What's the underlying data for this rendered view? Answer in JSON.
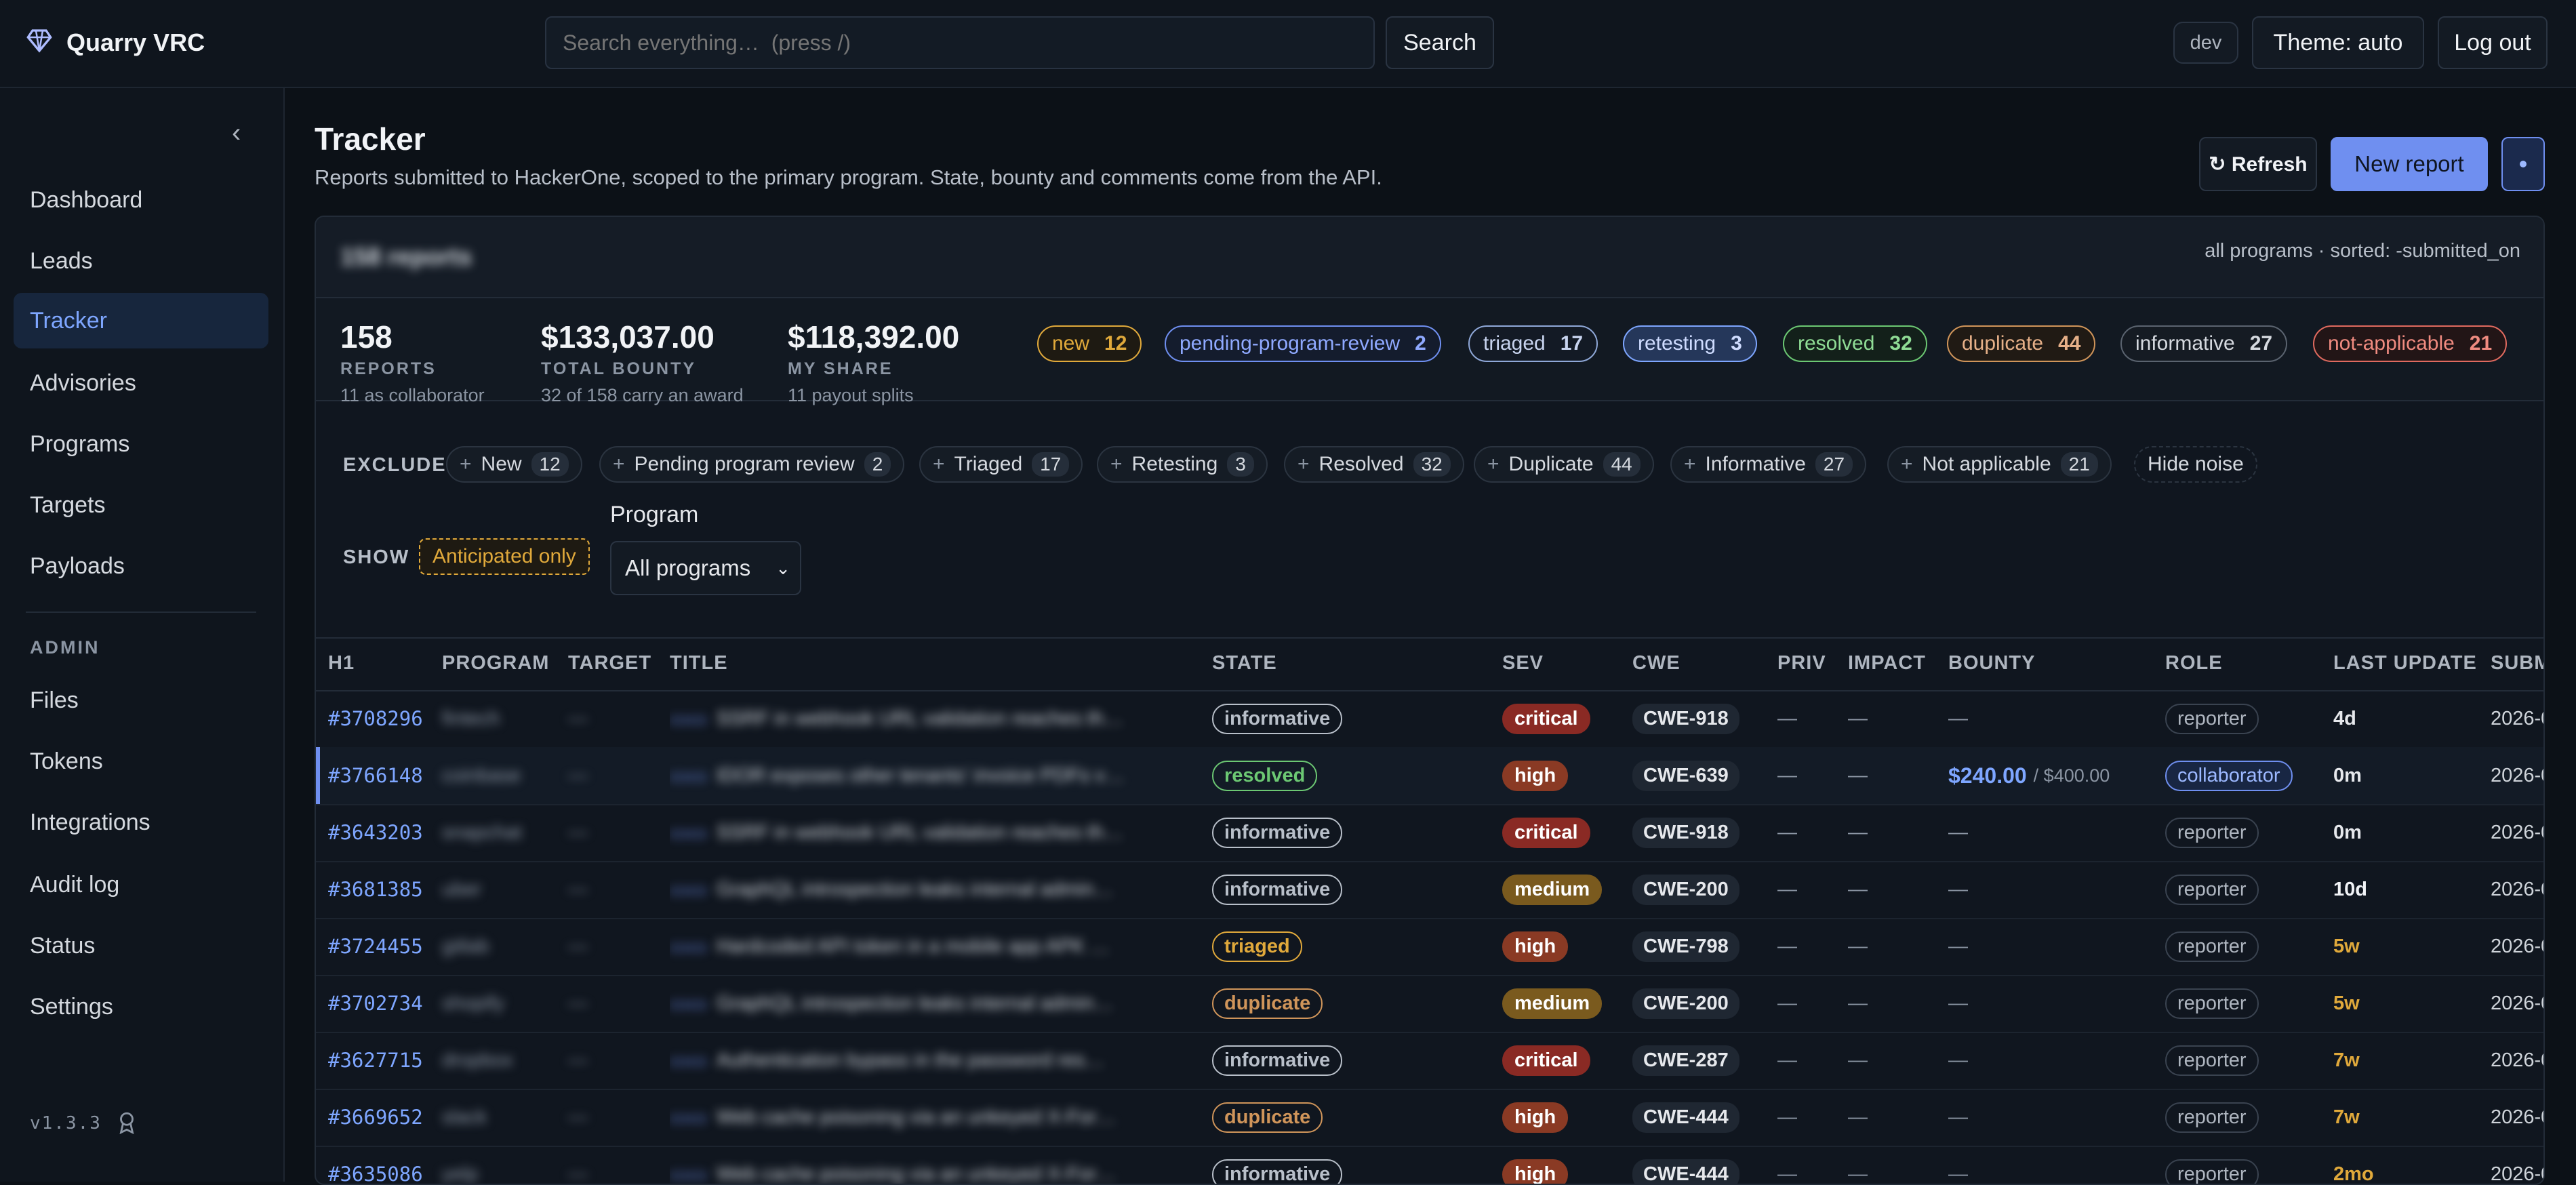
{
  "app": {
    "name": "Quarry VRC"
  },
  "search": {
    "placeholder": "Search everything…  (press /)",
    "button": "Search"
  },
  "top_actions": {
    "env_badge": "dev",
    "theme": "Theme: auto",
    "logout": "Log out"
  },
  "sidebar": {
    "items": [
      "Dashboard",
      "Leads",
      "Tracker",
      "Advisories",
      "Programs",
      "Targets",
      "Payloads"
    ],
    "admin_label": "ADMIN",
    "admin_items": [
      "Files",
      "Tokens",
      "Integrations",
      "Audit log",
      "Status",
      "Settings"
    ],
    "version": "v1.3.3",
    "active": "Tracker"
  },
  "page": {
    "title": "Tracker",
    "subtitle": "Reports submitted to HackerOne, scoped to the primary program. State, bounty and comments come from the API.",
    "refresh": "↻ Refresh",
    "new_report": "New report"
  },
  "panel": {
    "heading": "158 reports",
    "sort_info": "all programs · sorted: -submitted_on"
  },
  "stats": [
    {
      "value": "158",
      "label": "REPORTS",
      "sub": "11 as collaborator"
    },
    {
      "value": "$133,037.00",
      "label": "TOTAL BOUNTY",
      "sub": "32 of 158 carry an award"
    },
    {
      "value": "$118,392.00",
      "label": "MY SHARE",
      "sub": "11 payout splits"
    }
  ],
  "state_pills": [
    {
      "label": "new",
      "count": "12",
      "color": "#e0a93b"
    },
    {
      "label": "pending-program-review",
      "count": "2",
      "color": "#6f8ff0"
    },
    {
      "label": "triaged",
      "count": "17",
      "color": "#8fa8d8"
    },
    {
      "label": "retesting",
      "count": "3",
      "color": "#7ea6ff"
    },
    {
      "label": "resolved",
      "count": "32",
      "color": "#6cc873"
    },
    {
      "label": "duplicate",
      "count": "44",
      "color": "#d0955a"
    },
    {
      "label": "informative",
      "count": "27",
      "color": "#b8bfc9"
    },
    {
      "label": "not-applicable",
      "count": "21",
      "color": "#e06a5f"
    }
  ],
  "exclude": {
    "label": "EXCLUDE",
    "chips": [
      {
        "label": "New",
        "count": "12"
      },
      {
        "label": "Pending program review",
        "count": "2"
      },
      {
        "label": "Triaged",
        "count": "17"
      },
      {
        "label": "Retesting",
        "count": "3"
      },
      {
        "label": "Resolved",
        "count": "32"
      },
      {
        "label": "Duplicate",
        "count": "44"
      },
      {
        "label": "Informative",
        "count": "27"
      },
      {
        "label": "Not applicable",
        "count": "21"
      }
    ],
    "hide_noise": "Hide noise"
  },
  "show": {
    "label": "SHOW",
    "anticipated": "Anticipated only",
    "program_label": "Program",
    "program_value": "All programs"
  },
  "table": {
    "columns": [
      "H1",
      "PROGRAM",
      "TARGET",
      "TITLE",
      "STATE",
      "SEV",
      "CWE",
      "PRIV",
      "IMPACT",
      "BOUNTY",
      "ROLE",
      "LAST UPDATE",
      "SUBMITTED"
    ],
    "rows": [
      {
        "id": "#3708296",
        "program": "fintech",
        "target": "—",
        "title": "SSRF in webhook URL validation reaches th…",
        "state": "informative",
        "sev": "critical",
        "cwe": "CWE-918",
        "priv": "—",
        "impact": "—",
        "bounty": "—",
        "bounty_total": "",
        "role": "reporter",
        "updated": "4d",
        "updated_color": "#e6e8ec",
        "submitted": "2026-0"
      },
      {
        "id": "#3766148",
        "program": "coinbase",
        "target": "—",
        "title": "IDOR exposes other tenants' invoice PDFs v…",
        "state": "resolved",
        "sev": "high",
        "cwe": "CWE-639",
        "priv": "—",
        "impact": "—",
        "bounty": "$240.00",
        "bounty_total": "/ $400.00",
        "role": "collaborator",
        "updated": "0m",
        "updated_color": "#e6e8ec",
        "submitted": "2026-0"
      },
      {
        "id": "#3643203",
        "program": "snapchat",
        "target": "—",
        "title": "SSRF in webhook URL validation reaches th…",
        "state": "informative",
        "sev": "critical",
        "cwe": "CWE-918",
        "priv": "—",
        "impact": "—",
        "bounty": "—",
        "bounty_total": "",
        "role": "reporter",
        "updated": "0m",
        "updated_color": "#e6e8ec",
        "submitted": "2026-0"
      },
      {
        "id": "#3681385",
        "program": "uber",
        "target": "—",
        "title": "GraphQL introspection leaks internal admin…",
        "state": "informative",
        "sev": "medium",
        "cwe": "CWE-200",
        "priv": "—",
        "impact": "—",
        "bounty": "—",
        "bounty_total": "",
        "role": "reporter",
        "updated": "10d",
        "updated_color": "#f1f3f6",
        "submitted": "2026-0"
      },
      {
        "id": "#3724455",
        "program": "gitlab",
        "target": "—",
        "title": "Hardcoded API token in a mobile app APK …",
        "state": "triaged",
        "sev": "high",
        "cwe": "CWE-798",
        "priv": "—",
        "impact": "—",
        "bounty": "—",
        "bounty_total": "",
        "role": "reporter",
        "updated": "5w",
        "updated_color": "#e0a93b",
        "submitted": "2026-0"
      },
      {
        "id": "#3702734",
        "program": "shopify",
        "target": "—",
        "title": "GraphQL introspection leaks internal admin…",
        "state": "duplicate",
        "sev": "medium",
        "cwe": "CWE-200",
        "priv": "—",
        "impact": "—",
        "bounty": "—",
        "bounty_total": "",
        "role": "reporter",
        "updated": "5w",
        "updated_color": "#e0a93b",
        "submitted": "2026-0"
      },
      {
        "id": "#3627715",
        "program": "dropbox",
        "target": "—",
        "title": "Authentication bypass in the password res…",
        "state": "informative",
        "sev": "critical",
        "cwe": "CWE-287",
        "priv": "—",
        "impact": "—",
        "bounty": "—",
        "bounty_total": "",
        "role": "reporter",
        "updated": "7w",
        "updated_color": "#e0a93b",
        "submitted": "2026-0"
      },
      {
        "id": "#3669652",
        "program": "slack",
        "target": "—",
        "title": "Web cache poisoning via an unkeyed X-For…",
        "state": "duplicate",
        "sev": "high",
        "cwe": "CWE-444",
        "priv": "—",
        "impact": "—",
        "bounty": "—",
        "bounty_total": "",
        "role": "reporter",
        "updated": "7w",
        "updated_color": "#e0a93b",
        "submitted": "2026-0"
      },
      {
        "id": "#3635086",
        "program": "yelp",
        "target": "—",
        "title": "Web cache poisoning via an unkeyed X-For…",
        "state": "informative",
        "sev": "high",
        "cwe": "CWE-444",
        "priv": "—",
        "impact": "—",
        "bounty": "—",
        "bounty_total": "",
        "role": "reporter",
        "updated": "2mo",
        "updated_color": "#e0a93b",
        "submitted": "2026-0"
      }
    ]
  },
  "colors": {
    "accent": "#6f8ff0",
    "state": {
      "informative": "#b8bfc9",
      "resolved": "#6cc873",
      "triaged": "#e0a93b",
      "duplicate": "#d0955a"
    },
    "sev": {
      "critical": "#8a2a24",
      "high": "#8a3a24",
      "medium": "#7a5a1e"
    }
  }
}
